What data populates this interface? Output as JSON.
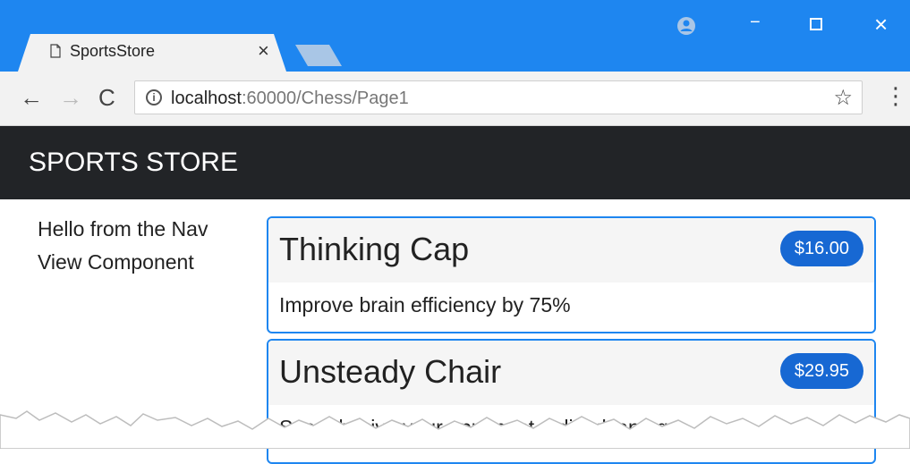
{
  "browser": {
    "tab_title": "SportsStore",
    "tab_close": "×",
    "window_controls": {
      "minimize": "−",
      "close": "×"
    },
    "nav": {
      "back": "←",
      "forward": "→",
      "reload": "C"
    },
    "url_host": "localhost",
    "url_rest": ":60000/Chess/Page1",
    "info_icon": "i",
    "star_icon": "☆",
    "menu_icon": "⋮",
    "accent_color": "#1e86f0"
  },
  "navbar": {
    "brand": "SPORTS STORE",
    "color": "#222427"
  },
  "sidebar": {
    "text": "Hello from the Nav View Component"
  },
  "products": [
    {
      "name": "Thinking Cap",
      "price": "$16.00",
      "description": "Improve brain efficiency by 75%"
    },
    {
      "name": "Unsteady Chair",
      "price": "$29.95",
      "description": "Secretly give your opponent a disadvantage"
    }
  ],
  "icons": [
    "document-icon",
    "profile-icon",
    "info-icon",
    "star-icon",
    "menu-icon"
  ]
}
